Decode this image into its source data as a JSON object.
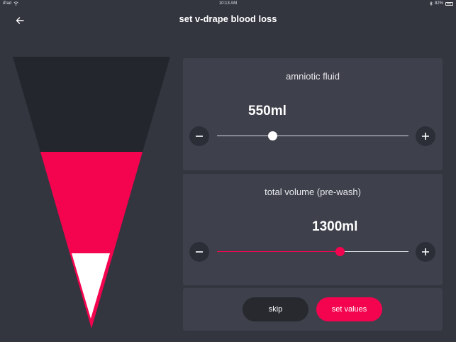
{
  "status_bar": {
    "device": "iPad",
    "time": "10:13 AM",
    "battery": "82%",
    "icons": [
      "wifi-icon",
      "bluetooth-icon",
      "battery-icon"
    ]
  },
  "header": {
    "title": "set v-drape blood loss",
    "back_icon": "arrow-left-icon"
  },
  "colors": {
    "background": "#33353f",
    "panel": "#3e404b",
    "accent": "#f4034f",
    "drape_dark": "#24262d",
    "button_dark": "#2c2e37",
    "skip_button": "#27292f"
  },
  "amniotic_fluid": {
    "label": "amniotic fluid",
    "value": "550ml",
    "slider_fraction": 0.29,
    "minus_label": "−",
    "plus_label": "+"
  },
  "total_volume": {
    "label": "total volume (pre-wash)",
    "value": "1300ml",
    "slider_fraction": 0.64,
    "minus_label": "−",
    "plus_label": "+"
  },
  "actions": {
    "skip_label": "skip",
    "set_values_label": "set values"
  }
}
